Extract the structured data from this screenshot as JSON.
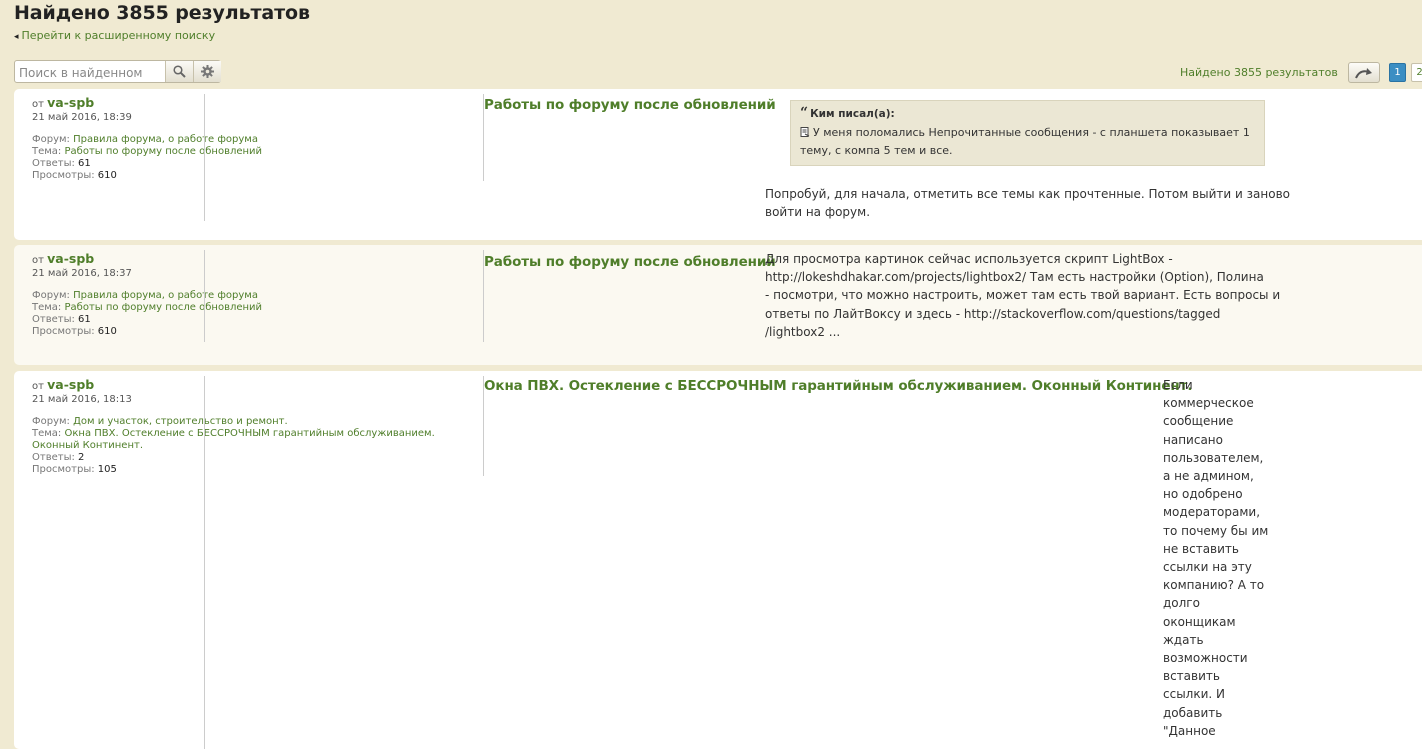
{
  "header": {
    "title": "Найдено 3855 результатов",
    "advanced_link": "Перейти к расширенному поиску"
  },
  "search": {
    "placeholder": "Поиск в найденном"
  },
  "pagination": {
    "results_text": "Найдено 3855 результатов",
    "current_page": "1",
    "next_page": "2"
  },
  "labels": {
    "from": "от",
    "forum": "Форум:",
    "topic": "Тема:",
    "replies": "Ответы:",
    "views": "Просмотры:"
  },
  "posts": [
    {
      "author": "va-spb",
      "date": "21 май 2016, 18:39",
      "forum": "Правила форума, о работе форума",
      "topic": "Работы по форуму после обновлений",
      "replies": "61",
      "views": "610",
      "title": "Работы по форуму после обновлений",
      "quote_author": "Ким писал(а):",
      "quote_line1": "У меня поломались Непрочитанные сообщения - с планшета показывает 1",
      "quote_line2": "тему, с компа 5 тем и все.",
      "body_lines": [
        "Попробуй, для начала, отметить все темы как прочтенные. Потом выйти и заново",
        "войти на форум."
      ],
      "edge": "п"
    },
    {
      "author": "va-spb",
      "date": "21 май 2016, 18:37",
      "forum": "Правила форума, о работе форума",
      "topic": "Работы по форуму после обновлений",
      "replies": "61",
      "views": "610",
      "title": "Работы по форуму после обновлений",
      "body_lines": [
        "Для просмотра картинок сейчас используется скрипт LightBox -",
        "http://lokeshdhakar.com/projects/lightbox2/ Там есть настройки (Option), Полина",
        "- посмотри, что можно настроить, может там есть твой вариант. Есть вопросы и",
        "ответы по ЛайтВоксу и здесь - http://stackoverflow.com/questions/tagged",
        "/lightbox2 ..."
      ],
      "edge": "п"
    },
    {
      "author": "va-spb",
      "date": "21 май 2016, 18:13",
      "forum": "Дом и участок, строительство и ремонт.",
      "topic_line1": "Окна ПВХ. Остекление с БЕССРОЧНЫМ гарантийным обслуживанием.",
      "topic_line2": "Оконный Континент.",
      "replies": "2",
      "views": "105",
      "title": "Окна ПВХ. Остекление с БЕССРОЧНЫМ гарантийным обслуживанием. Оконный Континент.",
      "body_lines": [
        "Если",
        "коммерческое",
        "сообщение",
        "написано",
        "пользователем,",
        "а не админом,",
        "но одобрено",
        "модераторами,",
        "то почему бы им",
        "не вставить",
        "ссылки на эту",
        "компанию? А то",
        "долго",
        "оконщикам",
        "ждать",
        "возможности",
        "вставить",
        "ссылки. И",
        "добавить",
        "\"Данное"
      ]
    }
  ],
  "icons": {
    "search": "magnifier-icon",
    "settings": "gear-icon",
    "jump": "curved-arrow-icon",
    "quote": "quote-marks-icon",
    "post_ref": "document-icon"
  },
  "colors": {
    "background": "#f0ead2",
    "link_green": "#4f7e2a",
    "active_page": "#3b8ec3"
  }
}
